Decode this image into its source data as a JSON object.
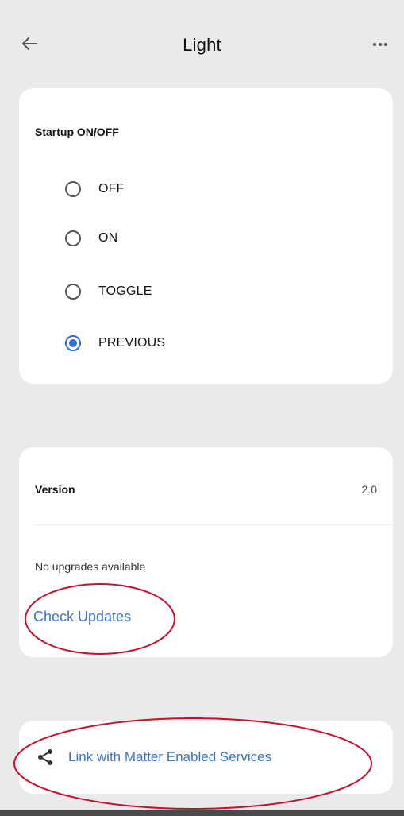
{
  "header": {
    "title": "Light",
    "back_icon": "arrow-left-icon",
    "more_icon": "more-horizontal-icon"
  },
  "startup": {
    "title": "Startup ON/OFF",
    "options": [
      {
        "label": "OFF",
        "selected": false
      },
      {
        "label": "ON",
        "selected": false
      },
      {
        "label": "TOGGLE",
        "selected": false
      },
      {
        "label": "PREVIOUS",
        "selected": true
      }
    ]
  },
  "version": {
    "label": "Version",
    "value": "2.0",
    "status": "No upgrades available",
    "check_updates": "Check Updates"
  },
  "link": {
    "icon": "share-icon",
    "label": "Link with Matter Enabled Services"
  },
  "colors": {
    "background": "#eaeaec",
    "card": "#ffffff",
    "accent": "#2f6fe0",
    "link_text": "#3a73c6",
    "annotation": "#c8102e"
  }
}
